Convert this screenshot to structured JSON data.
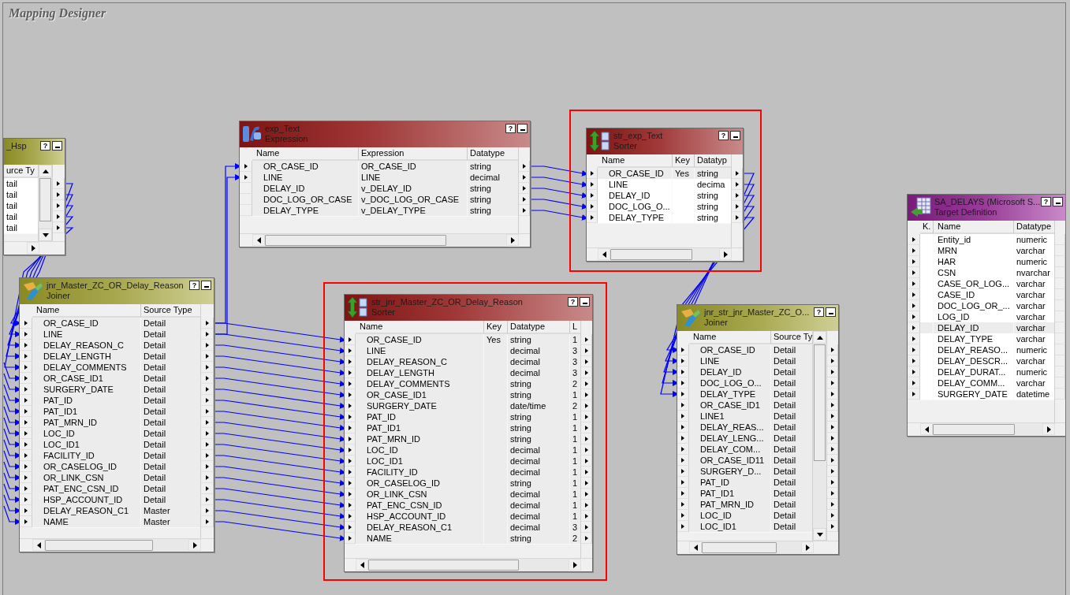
{
  "title": "Mapping Designer",
  "nodes": [
    {
      "kind": "joiner",
      "name": "_Hsp",
      "help": "?",
      "output_ports": true,
      "highlighted": false,
      "columns": [
        "urce Ty"
      ],
      "rows": [
        {
          "cells": [
            "tail"
          ],
          "selected": false
        },
        {
          "cells": [
            "tail"
          ],
          "selected": false
        },
        {
          "cells": [
            "tail"
          ],
          "selected": false
        },
        {
          "cells": [
            "tail"
          ],
          "selected": false
        },
        {
          "cells": [
            "tail"
          ],
          "selected": false
        }
      ]
    },
    {
      "kind": "expression",
      "name": "exp_Text",
      "type": "Expression",
      "help": "?",
      "output_ports": true,
      "highlighted": false,
      "columns": [
        "Name",
        "Expression",
        "Datatype"
      ],
      "rows": [
        {
          "cells": [
            "OR_CASE_ID",
            "OR_CASE_ID",
            "string"
          ],
          "selected": true,
          "input_port": true
        },
        {
          "cells": [
            "LINE",
            "LINE",
            "decimal"
          ],
          "selected": true,
          "input_port": true
        },
        {
          "cells": [
            "DELAY_ID",
            "v_DELAY_ID",
            "string"
          ],
          "selected": true,
          "input_port": false
        },
        {
          "cells": [
            "DOC_LOG_OR_CASE",
            "v_DOC_LOG_OR_CASE",
            "string"
          ],
          "selected": true,
          "input_port": false
        },
        {
          "cells": [
            "DELAY_TYPE",
            "v_DELAY_TYPE",
            "string"
          ],
          "selected": true,
          "input_port": false
        }
      ]
    },
    {
      "kind": "sorter",
      "name": "str_exp_Text",
      "type": "Sorter",
      "help": "?",
      "output_ports": true,
      "highlighted": true,
      "columns": [
        "Name",
        "Key",
        "Datatyp"
      ],
      "rows": [
        {
          "cells": [
            "OR_CASE_ID",
            "Yes",
            "string"
          ],
          "selected": true,
          "input_port": true
        },
        {
          "cells": [
            "LINE",
            "",
            "decima"
          ],
          "selected": false,
          "input_port": true
        },
        {
          "cells": [
            "DELAY_ID",
            "",
            "string"
          ],
          "selected": false,
          "input_port": true
        },
        {
          "cells": [
            "DOC_LOG_O...",
            "",
            "string"
          ],
          "selected": false,
          "input_port": true
        },
        {
          "cells": [
            "DELAY_TYPE",
            "",
            "string"
          ],
          "selected": false,
          "input_port": true
        }
      ]
    },
    {
      "kind": "joiner",
      "name": "jnr_Master_ZC_OR_Delay_Reason",
      "type": "Joiner",
      "help": "?",
      "output_ports": true,
      "highlighted": false,
      "columns": [
        "Name",
        "Source Type"
      ],
      "rows": [
        {
          "cells": [
            "OR_CASE_ID",
            "Detail"
          ],
          "selected": true,
          "input_port": true
        },
        {
          "cells": [
            "LINE",
            "Detail"
          ],
          "selected": true,
          "input_port": true
        },
        {
          "cells": [
            "DELAY_REASON_C",
            "Detail"
          ],
          "selected": true,
          "input_port": true
        },
        {
          "cells": [
            "DELAY_LENGTH",
            "Detail"
          ],
          "selected": true,
          "input_port": true
        },
        {
          "cells": [
            "DELAY_COMMENTS",
            "Detail"
          ],
          "selected": true,
          "input_port": true
        },
        {
          "cells": [
            "OR_CASE_ID1",
            "Detail"
          ],
          "selected": true,
          "input_port": true
        },
        {
          "cells": [
            "SURGERY_DATE",
            "Detail"
          ],
          "selected": true,
          "input_port": true
        },
        {
          "cells": [
            "PAT_ID",
            "Detail"
          ],
          "selected": true,
          "input_port": true
        },
        {
          "cells": [
            "PAT_ID1",
            "Detail"
          ],
          "selected": true,
          "input_port": true
        },
        {
          "cells": [
            "PAT_MRN_ID",
            "Detail"
          ],
          "selected": true,
          "input_port": true
        },
        {
          "cells": [
            "LOC_ID",
            "Detail"
          ],
          "selected": true,
          "input_port": true
        },
        {
          "cells": [
            "LOC_ID1",
            "Detail"
          ],
          "selected": true,
          "input_port": true
        },
        {
          "cells": [
            "FACILITY_ID",
            "Detail"
          ],
          "selected": true,
          "input_port": true
        },
        {
          "cells": [
            "OR_CASELOG_ID",
            "Detail"
          ],
          "selected": true,
          "input_port": true
        },
        {
          "cells": [
            "OR_LINK_CSN",
            "Detail"
          ],
          "selected": true,
          "input_port": true
        },
        {
          "cells": [
            "PAT_ENC_CSN_ID",
            "Detail"
          ],
          "selected": true,
          "input_port": true
        },
        {
          "cells": [
            "HSP_ACCOUNT_ID",
            "Detail"
          ],
          "selected": true,
          "input_port": true
        },
        {
          "cells": [
            "DELAY_REASON_C1",
            "Master"
          ],
          "selected": true,
          "input_port": true
        },
        {
          "cells": [
            "NAME",
            "Master"
          ],
          "selected": true,
          "input_port": true
        }
      ]
    },
    {
      "kind": "sorter",
      "name": "str_jnr_Master_ZC_OR_Delay_Reason",
      "type": "Sorter",
      "help": "?",
      "output_ports": true,
      "highlighted": true,
      "columns": [
        "Name",
        "Key",
        "Datatype",
        "L"
      ],
      "rows": [
        {
          "cells": [
            "OR_CASE_ID",
            "Yes",
            "string",
            "1"
          ],
          "selected": true,
          "input_port": true
        },
        {
          "cells": [
            "LINE",
            "",
            "decimal",
            "3"
          ],
          "selected": true,
          "input_port": true
        },
        {
          "cells": [
            "DELAY_REASON_C",
            "",
            "decimal",
            "3"
          ],
          "selected": true,
          "input_port": true
        },
        {
          "cells": [
            "DELAY_LENGTH",
            "",
            "decimal",
            "3"
          ],
          "selected": true,
          "input_port": true
        },
        {
          "cells": [
            "DELAY_COMMENTS",
            "",
            "string",
            "2"
          ],
          "selected": true,
          "input_port": true
        },
        {
          "cells": [
            "OR_CASE_ID1",
            "",
            "string",
            "1"
          ],
          "selected": true,
          "input_port": true
        },
        {
          "cells": [
            "SURGERY_DATE",
            "",
            "date/time",
            "2"
          ],
          "selected": true,
          "input_port": true
        },
        {
          "cells": [
            "PAT_ID",
            "",
            "string",
            "1"
          ],
          "selected": true,
          "input_port": true
        },
        {
          "cells": [
            "PAT_ID1",
            "",
            "string",
            "1"
          ],
          "selected": true,
          "input_port": true
        },
        {
          "cells": [
            "PAT_MRN_ID",
            "",
            "string",
            "1"
          ],
          "selected": true,
          "input_port": true
        },
        {
          "cells": [
            "LOC_ID",
            "",
            "decimal",
            "1"
          ],
          "selected": true,
          "input_port": true
        },
        {
          "cells": [
            "LOC_ID1",
            "",
            "decimal",
            "1"
          ],
          "selected": true,
          "input_port": true
        },
        {
          "cells": [
            "FACILITY_ID",
            "",
            "decimal",
            "1"
          ],
          "selected": true,
          "input_port": true
        },
        {
          "cells": [
            "OR_CASELOG_ID",
            "",
            "string",
            "1"
          ],
          "selected": true,
          "input_port": true
        },
        {
          "cells": [
            "OR_LINK_CSN",
            "",
            "decimal",
            "1"
          ],
          "selected": true,
          "input_port": true
        },
        {
          "cells": [
            "PAT_ENC_CSN_ID",
            "",
            "decimal",
            "1"
          ],
          "selected": true,
          "input_port": true
        },
        {
          "cells": [
            "HSP_ACCOUNT_ID",
            "",
            "decimal",
            "1"
          ],
          "selected": true,
          "input_port": true
        },
        {
          "cells": [
            "DELAY_REASON_C1",
            "",
            "decimal",
            "3"
          ],
          "selected": true,
          "input_port": true
        },
        {
          "cells": [
            "NAME",
            "",
            "string",
            "2"
          ],
          "selected": true,
          "input_port": true
        }
      ]
    },
    {
      "kind": "joiner",
      "name": "jnr_str_jnr_Master_ZC_O...",
      "type": "Joiner",
      "help": "?",
      "output_ports": true,
      "highlighted": false,
      "columns": [
        "Name",
        "Source Ty"
      ],
      "rows": [
        {
          "cells": [
            "OR_CASE_ID",
            "Detail"
          ],
          "selected": true,
          "input_port": true
        },
        {
          "cells": [
            "LINE",
            "Detail"
          ],
          "selected": true,
          "input_port": true
        },
        {
          "cells": [
            "DELAY_ID",
            "Detail"
          ],
          "selected": true,
          "input_port": true
        },
        {
          "cells": [
            "DOC_LOG_O...",
            "Detail"
          ],
          "selected": true,
          "input_port": true
        },
        {
          "cells": [
            "DELAY_TYPE",
            "Detail"
          ],
          "selected": true,
          "input_port": true
        },
        {
          "cells": [
            "OR_CASE_ID1",
            "Detail"
          ],
          "selected": true,
          "input_port": true
        },
        {
          "cells": [
            "LINE1",
            "Detail"
          ],
          "selected": true,
          "input_port": true
        },
        {
          "cells": [
            "DELAY_REAS...",
            "Detail"
          ],
          "selected": true,
          "input_port": true
        },
        {
          "cells": [
            "DELAY_LENG...",
            "Detail"
          ],
          "selected": true,
          "input_port": true
        },
        {
          "cells": [
            "DELAY_COM...",
            "Detail"
          ],
          "selected": true,
          "input_port": true
        },
        {
          "cells": [
            "OR_CASE_ID11",
            "Detail"
          ],
          "selected": true,
          "input_port": true
        },
        {
          "cells": [
            "SURGERY_D...",
            "Detail"
          ],
          "selected": true,
          "input_port": true
        },
        {
          "cells": [
            "PAT_ID",
            "Detail"
          ],
          "selected": true,
          "input_port": true
        },
        {
          "cells": [
            "PAT_ID1",
            "Detail"
          ],
          "selected": true,
          "input_port": true
        },
        {
          "cells": [
            "PAT_MRN_ID",
            "Detail"
          ],
          "selected": true,
          "input_port": true
        },
        {
          "cells": [
            "LOC_ID",
            "Detail"
          ],
          "selected": true,
          "input_port": true
        },
        {
          "cells": [
            "LOC_ID1",
            "Detail"
          ],
          "selected": true,
          "input_port": true
        }
      ]
    },
    {
      "kind": "target",
      "name": "SA_DELAYS (Microsoft S...",
      "type": "Target Definition",
      "help": "?",
      "output_ports": false,
      "highlighted": false,
      "columns": [
        "K.",
        "Name",
        "Datatype"
      ],
      "rows": [
        {
          "cells": [
            "",
            "Entity_id",
            "numeric"
          ],
          "selected": false,
          "input_port": true
        },
        {
          "cells": [
            "",
            "MRN",
            "varchar"
          ],
          "selected": false,
          "input_port": true
        },
        {
          "cells": [
            "",
            "HAR",
            "numeric"
          ],
          "selected": false,
          "input_port": true
        },
        {
          "cells": [
            "",
            "CSN",
            "nvarchar"
          ],
          "selected": false,
          "input_port": true
        },
        {
          "cells": [
            "",
            "CASE_OR_LOG...",
            "varchar"
          ],
          "selected": false,
          "input_port": true
        },
        {
          "cells": [
            "",
            "CASE_ID",
            "varchar"
          ],
          "selected": false,
          "input_port": true
        },
        {
          "cells": [
            "",
            "DOC_LOG_OR_...",
            "varchar"
          ],
          "selected": false,
          "input_port": true
        },
        {
          "cells": [
            "",
            "LOG_ID",
            "varchar"
          ],
          "selected": false,
          "input_port": true
        },
        {
          "cells": [
            "",
            "DELAY_ID",
            "varchar"
          ],
          "selected": true,
          "input_port": true
        },
        {
          "cells": [
            "",
            "DELAY_TYPE",
            "varchar"
          ],
          "selected": false,
          "input_port": true
        },
        {
          "cells": [
            "",
            "DELAY_REASO...",
            "numeric"
          ],
          "selected": false,
          "input_port": true
        },
        {
          "cells": [
            "",
            "DELAY_DESCR...",
            "varchar"
          ],
          "selected": false,
          "input_port": true
        },
        {
          "cells": [
            "",
            "DELAY_DURAT...",
            "numeric"
          ],
          "selected": false,
          "input_port": true
        },
        {
          "cells": [
            "",
            "DELAY_COMM...",
            "varchar"
          ],
          "selected": false,
          "input_port": true
        },
        {
          "cells": [
            "",
            "SURGERY_DATE",
            "datetime"
          ],
          "selected": false,
          "input_port": true
        }
      ]
    }
  ]
}
